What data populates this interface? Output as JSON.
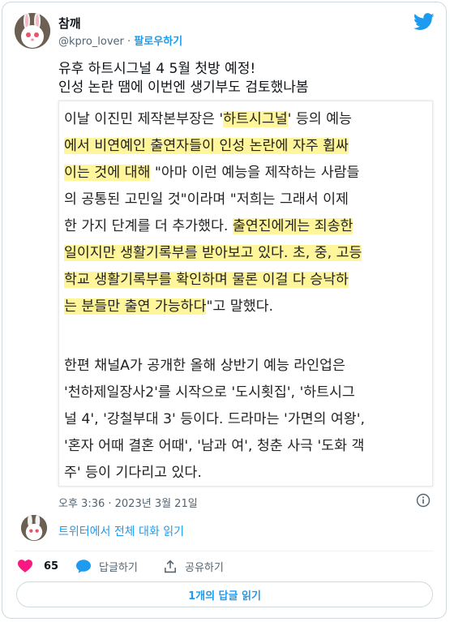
{
  "colors": {
    "accent": "#1d9bf0",
    "like": "#f91880",
    "highlight": "#fff59a",
    "muted": "#536471"
  },
  "user": {
    "display_name": "참깨",
    "handle": "@kpro_lover",
    "separator": "·",
    "follow_label": "팔로우하기"
  },
  "tweet": {
    "lines": [
      "유후 하트시그널 4 5월 첫방 예정!",
      "인성 논란 땜에 이번엔 생기부도 검토했나봄"
    ]
  },
  "quote_image": {
    "paragraph1": [
      [
        {
          "t": "이날 이진민 제작본부장은 '",
          "h": false
        },
        {
          "t": "하트시그널",
          "h": true
        },
        {
          "t": "' 등의 예능",
          "h": false
        }
      ],
      [
        {
          "t": "에서 비연예인 출연자들이 인성 논란에 자주 휩싸",
          "h": true
        }
      ],
      [
        {
          "t": "이는 것에 대해",
          "h": true
        },
        {
          "t": " \"아마 이런 예능을 제작하는 사람들",
          "h": false
        }
      ],
      [
        {
          "t": "의 공통된 고민일 것\"이라며 \"저희는 그래서 이제",
          "h": false
        }
      ],
      [
        {
          "t": "한 가지 단계를 더 추가했다. ",
          "h": false
        },
        {
          "t": "출연진에게는 죄송한",
          "h": true
        }
      ],
      [
        {
          "t": "일이지만 생활기록부를 받아보고 있다. 초, 중, 고등",
          "h": true
        }
      ],
      [
        {
          "t": "학교 생활기록부를 확인하며 물론 이걸 다 승낙하",
          "h": true
        }
      ],
      [
        {
          "t": "는 분들만 출연 가능하다",
          "h": true
        },
        {
          "t": "\"고 말했다.",
          "h": false
        }
      ]
    ],
    "paragraph2": [
      "한편 채널A가 공개한 올해 상반기 예능 라인업은",
      "'천하제일장사2'를 시작으로 '도시횟집', '하트시그",
      "널 4', '강철부대 3' 등이다. 드라마는 '가면의 여왕',",
      "'혼자 어때 결혼 어때', '남과 여', 청춘 사극 '도화 객",
      "주' 등이 기다리고 있다."
    ]
  },
  "timestamp": "오후 3:36 · 2023년 3월 21일",
  "read_conversation": "트위터에서 전체 대화 읽기",
  "actions": {
    "like_count": "65",
    "reply_label": "답글하기",
    "share_label": "공유하기"
  },
  "read_replies": "1개의 답글 읽기",
  "icons": {
    "logo": "twitter-bird-icon",
    "info": "info-icon",
    "like": "heart-icon",
    "reply": "reply-bubble-icon",
    "share": "share-icon"
  }
}
